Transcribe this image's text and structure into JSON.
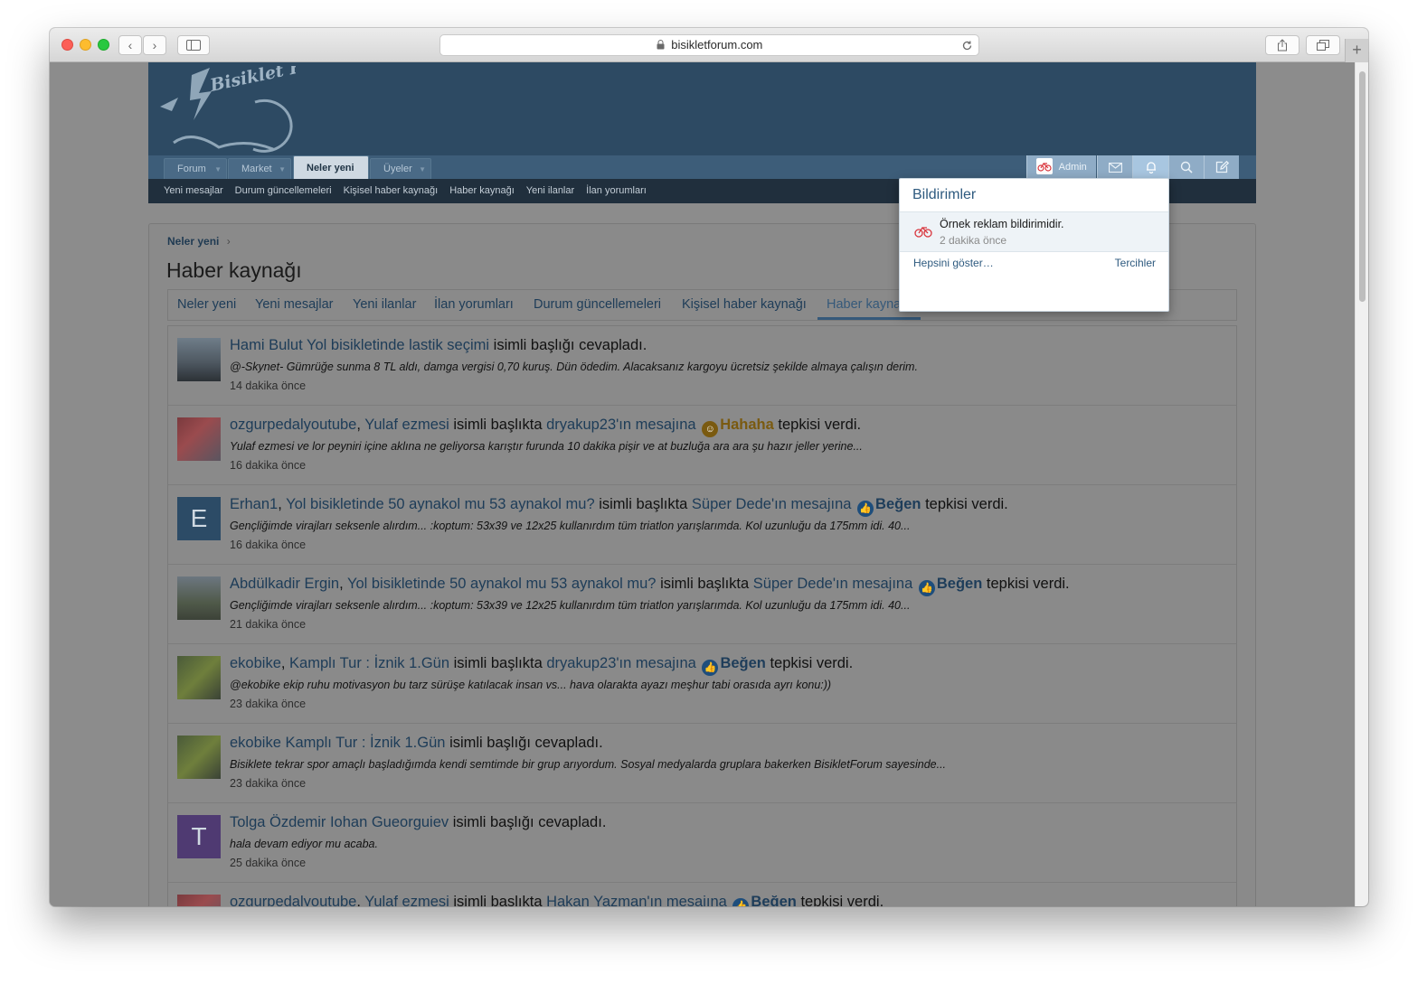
{
  "browser": {
    "url": "bisikletforum.com"
  },
  "site": {
    "logo_text": "Bisiklet Forum",
    "nav_tabs": [
      {
        "label": "Forum"
      },
      {
        "label": "Market"
      },
      {
        "label": "Neler yeni"
      },
      {
        "label": "Üyeler"
      }
    ],
    "subnav": [
      "Yeni mesajlar",
      "Durum güncellemeleri",
      "Kişisel haber kaynağı",
      "Haber kaynağı",
      "Yeni ilanlar",
      "İlan yorumları"
    ],
    "user": {
      "name": "Admin"
    }
  },
  "page": {
    "breadcrumb": "Neler yeni",
    "title": "Haber kaynağı",
    "tabs": [
      "Neler yeni",
      "Yeni mesajlar",
      "Yeni ilanlar",
      "İlan yorumları",
      "Durum güncellemeleri",
      "Kişisel haber kaynağı",
      "Haber kaynağı"
    ]
  },
  "feed": [
    {
      "user": "Hami Bulut",
      "thread": "Yol bisikletinde lastik seçimi",
      "text1": "isimli başlığı cevapladı.",
      "snippet": "@-Skynet- Gümrüğe sunma 8 TL aldı, damga vergisi 0,70 kuruş. Dün ödedim. Alacaksanız kargoyu ücretsiz şekilde almaya çalışın derim.",
      "time": "14 dakika önce"
    },
    {
      "user": "ozgurpedalyoutube",
      "thread": "Yulaf ezmesi",
      "mid": "isimli başlıkta",
      "target": "dryakup23'ın mesajına",
      "reaction": "Hahaha",
      "end": "tepkisi verdi.",
      "snippet": "Yulaf ezmesi ve lor peyniri içine aklına ne geliyorsa karıştır furunda 10 dakika pişir ve at buzluğa ara ara şu hazır jeller yerine...",
      "time": "16 dakika önce"
    },
    {
      "user": "Erhan1",
      "avatar_letter": "E",
      "thread": "Yol bisikletinde 50 aynakol mu 53 aynakol mu?",
      "mid": "isimli başlıkta",
      "target": "Süper Dede'ın mesajına",
      "reaction": "Beğen",
      "end": "tepkisi verdi.",
      "snippet": "Gençliğimde virajları seksenle alırdım... :koptum: 53x39 ve 12x25 kullanırdım tüm triatlon yarışlarımda. Kol uzunluğu da 175mm idi. 40...",
      "time": "16 dakika önce"
    },
    {
      "user": "Abdülkadir Ergin",
      "thread": "Yol bisikletinde 50 aynakol mu 53 aynakol mu?",
      "mid": "isimli başlıkta",
      "target": "Süper Dede'ın mesajına",
      "reaction": "Beğen",
      "end": "tepkisi verdi.",
      "snippet": "Gençliğimde virajları seksenle alırdım... :koptum: 53x39 ve 12x25 kullanırdım tüm triatlon yarışlarımda. Kol uzunluğu da 175mm idi. 40...",
      "time": "21 dakika önce"
    },
    {
      "user": "ekobike",
      "thread": "Kamplı Tur : İznik 1.Gün",
      "mid": "isimli başlıkta",
      "target": "dryakup23'ın mesajına",
      "reaction": "Beğen",
      "end": "tepkisi verdi.",
      "snippet": "@ekobike ekip ruhu motivasyon bu tarz sürüşe katılacak insan vs... hava olarakta ayazı meşhur tabi orasıda ayrı konu:))",
      "time": "23 dakika önce"
    },
    {
      "user": "ekobike",
      "thread": "Kamplı Tur : İznik 1.Gün",
      "text1": "isimli başlığı cevapladı.",
      "snippet": "Bisiklete tekrar spor amaçlı başladığımda kendi semtimde bir grup arıyordum. Sosyal medyalarda gruplara bakerken BisikletForum sayesinde...",
      "time": "23 dakika önce"
    },
    {
      "user": "Tolga Özdemir",
      "avatar_letter": "T",
      "thread": "Iohan Gueorguiev",
      "text1": "isimli başlığı cevapladı.",
      "snippet": "hala devam ediyor mu acaba.",
      "time": "25 dakika önce"
    },
    {
      "user": "ozgurpedalyoutube",
      "thread": "Yulaf ezmesi",
      "mid": "isimli başlıkta",
      "target": "Hakan Yazman'ın mesajına",
      "reaction": "Beğen",
      "end": "tepkisi verdi."
    }
  ],
  "notifications": {
    "title": "Bildirimler",
    "item_text": "Örnek reklam bildirimidir.",
    "item_time": "2 dakika önce",
    "show_all": "Hepsini göster…",
    "prefs": "Tercihler"
  }
}
